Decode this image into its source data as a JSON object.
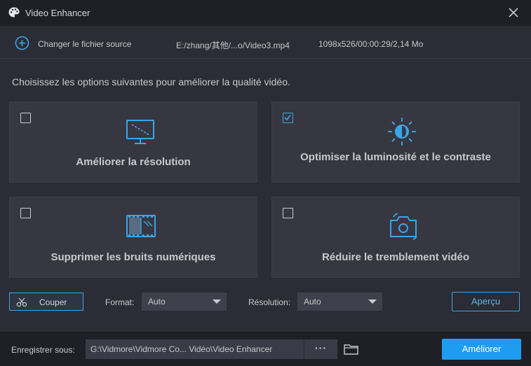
{
  "window": {
    "title": "Video Enhancer",
    "app_icon": "palette-icon",
    "close_icon": "close-icon"
  },
  "source": {
    "change_label": "Changer le fichier source",
    "file_path": "E:/zhang/其他/...o/Video3.mp4",
    "file_info": "1098x526/00:00:29/2,14 Mo"
  },
  "instruction": "Choisissez les options suivantes pour améliorer la qualité vidéo.",
  "options": [
    {
      "label": "Améliorer la résolution",
      "checked": false,
      "icon": "monitor-upscale-icon"
    },
    {
      "label": "Optimiser la luminosité et le contraste",
      "checked": true,
      "icon": "brightness-icon"
    },
    {
      "label": "Supprimer les bruits numériques",
      "checked": false,
      "icon": "film-noise-icon"
    },
    {
      "label": "Réduire le tremblement vidéo",
      "checked": false,
      "icon": "camera-shake-icon"
    }
  ],
  "controls": {
    "cut_label": "Couper",
    "format_label": "Format:",
    "format_value": "Auto",
    "resolution_label": "Résolution:",
    "resolution_value": "Auto",
    "preview_label": "Aperçu"
  },
  "footer": {
    "save_label": "Enregistrer sous:",
    "save_path": "G:\\Vidmore\\Vidmore Co... Vidéo\\Video Enhancer",
    "browse_label": "···",
    "enhance_label": "Améliorer"
  },
  "colors": {
    "accent": "#1e9df0",
    "background": "#2b2c35",
    "titlebar": "#1f2027",
    "card": "#363741"
  }
}
